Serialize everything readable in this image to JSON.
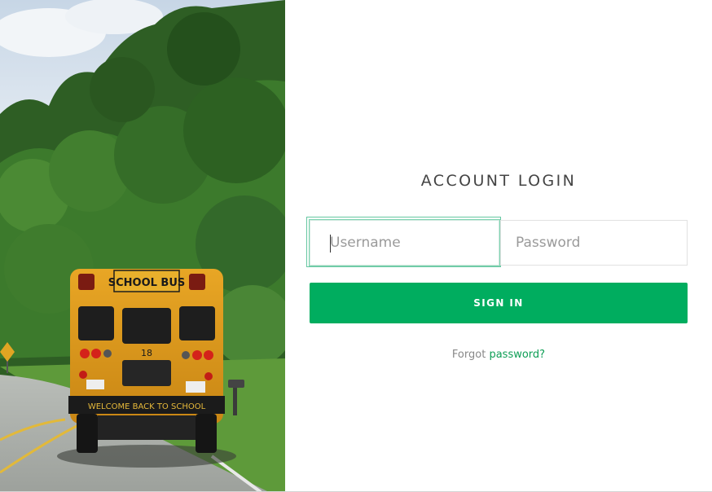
{
  "login": {
    "title": "ACCOUNT LOGIN",
    "username_placeholder": "Username",
    "password_placeholder": "Password",
    "signin_label": "SIGN IN",
    "forgot_prefix": "Forgot",
    "forgot_link": "password?"
  },
  "hero": {
    "bus_sign": "SCHOOL BUS",
    "bus_number": "18",
    "bumper_text": "WELCOME BACK TO SCHOOL"
  },
  "colors": {
    "accent": "#00ad5f",
    "link": "#0d9e55",
    "title_text": "#444444"
  }
}
